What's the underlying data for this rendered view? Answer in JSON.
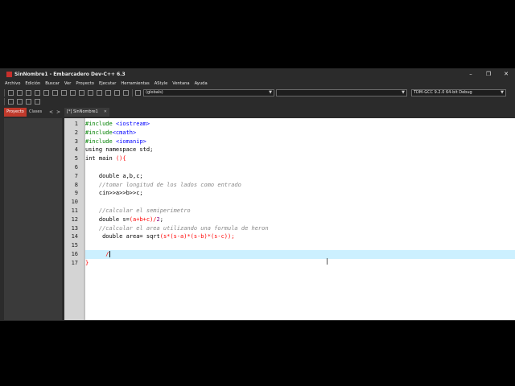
{
  "window": {
    "title": "SinNombre1 - Embarcadero Dev-C++ 6.3",
    "controls": [
      "–",
      "❐",
      "✕"
    ]
  },
  "menu": [
    "Archivo",
    "Edición",
    "Buscar",
    "Ver",
    "Proyecto",
    "Ejecutar",
    "Herramientas",
    "AStyle",
    "Ventana",
    "Ayuda"
  ],
  "toolbar": {
    "scope_combo": "(globals)",
    "symbol_combo": "",
    "compiler_combo": "TDM-GCC 9.2.0 64-bit Debug"
  },
  "left_panel": {
    "tab_project": "Proyecto",
    "tab_classes": "Clases",
    "nav_prev": "<",
    "nav_next": ">"
  },
  "editor": {
    "file_tab": "[*] SinNombre1",
    "file_tab_close": "✕",
    "current_line": 16,
    "line_numbers": [
      "1",
      "2",
      "3",
      "4",
      "5",
      "6",
      "7",
      "8",
      "9",
      "10",
      "11",
      "12",
      "13",
      "14",
      "15",
      "16",
      "17"
    ]
  },
  "code": {
    "l1": {
      "directive": "#include ",
      "header": "<iostream>"
    },
    "l2": {
      "directive": "#include",
      "header": "<cmath>"
    },
    "l3": {
      "directive": "#include ",
      "header": "<iomanip>"
    },
    "l4": "using namespace std;",
    "l5": {
      "a": "int main ",
      "b": "(){"
    },
    "l6": "",
    "l7": {
      "indent": "    ",
      "text": "double a,b,c;"
    },
    "l8": {
      "indent": "    ",
      "comment": "//tomar longitud de los lados como entrado"
    },
    "l9": {
      "indent": "    ",
      "text": "cin>>a>>b>>c;"
    },
    "l10": "",
    "l11": {
      "indent": "    ",
      "comment": "//calcular el semiperimetro"
    },
    "l12": {
      "indent": "    ",
      "a": "double s=",
      "b": "(a+b+c)/",
      "num": "2",
      "c": ";"
    },
    "l13": {
      "indent": "    ",
      "comment": "//calcular el area utilizando una formula de heron"
    },
    "l14": {
      "indent": "     ",
      "a": "double area= sqrt",
      "b": "(s*(s-a)*(s-b)*(s-c));"
    },
    "l15": "",
    "l16": {
      "indent": "      ",
      "text": "/"
    },
    "l17": "}"
  }
}
